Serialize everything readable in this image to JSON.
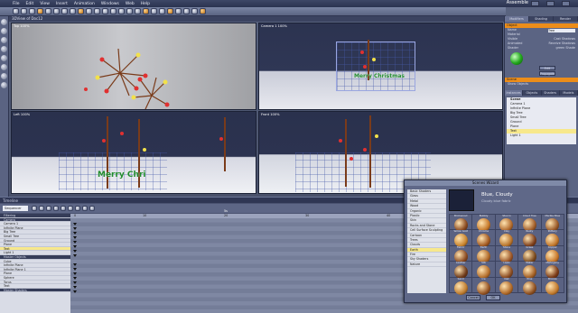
{
  "menu": {
    "items": [
      "File",
      "Edit",
      "View",
      "Insert",
      "Animation",
      "Windows",
      "Web",
      "Help"
    ],
    "brand": "Assemble"
  },
  "viewport_header": "3DView of Doc12",
  "viewports": [
    {
      "label": "Top 100%"
    },
    {
      "label": "Camera 1 100%"
    },
    {
      "label": "Left 100%"
    },
    {
      "label": "Front 100%"
    }
  ],
  "scene_text": "Merry Christmas",
  "left_text": "Merry Chri",
  "right_panel": {
    "tabs": [
      "Modifiers",
      "Shading",
      "Render"
    ],
    "header": "Object",
    "name_label": "Name",
    "name_value": "Tree",
    "material_label": "Material",
    "checks": [
      "Visible",
      "Cast Shadows",
      "Animated",
      "Receive Shadows"
    ],
    "shader_label": "Shader",
    "shader_value": "green Shade",
    "edit_btn": "Edit",
    "apply_btn": "Propagate",
    "section2": "Scene",
    "scene_options": [
      "Show Objects",
      "Tree",
      "Small Tree"
    ],
    "lower_tabs": [
      "Instances",
      "Objects",
      "Shaders",
      "Models",
      "Tex"
    ],
    "scene_title": "Scene",
    "scene_items": [
      "Camera 1",
      "Infinite Plane",
      "Big Tree",
      "Small Tree",
      "Ground",
      "Plane",
      "Text",
      "Light 1"
    ],
    "selected_scene_item": "Text"
  },
  "timeline": {
    "title": "Timeline",
    "selector": "Sequencer",
    "ruler": [
      "0",
      "10",
      "20",
      "30",
      "40",
      "50"
    ],
    "marker": "5s",
    "tracks": [
      "Filtering",
      "Camera",
      "Camera 1",
      "Infinite Plane",
      "Big Tree",
      "Small Tree",
      "Ground",
      "Plane",
      "Text",
      "Light 1",
      "Master Objects",
      "Cube",
      "Infinite Plane",
      "Infinite Plane 1",
      "Plane",
      "Sphere",
      "Torus",
      "Text",
      "Master Shaders"
    ],
    "selected_track": "Text"
  },
  "wizard": {
    "title": "Scenes Wizard",
    "categories": [
      "Basic Shaders",
      "Glass",
      "Metal",
      "Wood",
      "Organic",
      "Plastic",
      "Skin",
      "Rocks and Stone",
      "Cell Surface Sculpting",
      "Cartoon",
      "Trees",
      "Clouds",
      "Earth",
      "Fire",
      "Sky Shaders",
      "Nature"
    ],
    "selected_category": "Earth",
    "selected_name": "Blue, Cloudy",
    "selected_sub": "Cloudy blue fabric",
    "swatches": [
      {
        "label": "Brickwood",
        "color": "#8a4a20"
      },
      {
        "label": "Bubbly",
        "color": "#c77a2a"
      },
      {
        "label": "Stucco",
        "color": "#b26b2e"
      },
      {
        "label": "Cloud Tree",
        "color": "#a05d2a"
      },
      {
        "label": "Marble Blue",
        "color": "#9a5a28"
      },
      {
        "label": "Yellow Gold",
        "color": "#c9852f"
      },
      {
        "label": "Chrome",
        "color": "#a25a22"
      },
      {
        "label": "Clay",
        "color": "#b8742c"
      },
      {
        "label": "Rusty",
        "color": "#7e3f1c"
      },
      {
        "label": "Pottery",
        "color": "#c0762c"
      },
      {
        "label": "Fabric",
        "color": "#8b4b22"
      },
      {
        "label": "Earth",
        "color": "#b06a2a"
      },
      {
        "label": "Stone",
        "color": "#9b5628"
      },
      {
        "label": "Grass",
        "color": "#7a4a1e"
      },
      {
        "label": "Copper",
        "color": "#c8782a"
      },
      {
        "label": "Leather",
        "color": "#6e3a1a"
      },
      {
        "label": "Silk",
        "color": "#b46f2d"
      },
      {
        "label": "Lapis",
        "color": "#8c4e24"
      },
      {
        "label": "Water",
        "color": "#a36026"
      },
      {
        "label": "Mahogany",
        "color": "#7a3a18"
      },
      {
        "label": "Sand",
        "color": "#bf7d30"
      },
      {
        "label": "Ice",
        "color": "#955424"
      },
      {
        "label": "Oak",
        "color": "#b06928"
      },
      {
        "label": "Pine",
        "color": "#8e5022"
      },
      {
        "label": "Bronze",
        "color": "#c27b2e"
      }
    ],
    "ok_btn": "Cancel",
    "cancel_btn": "OK"
  }
}
